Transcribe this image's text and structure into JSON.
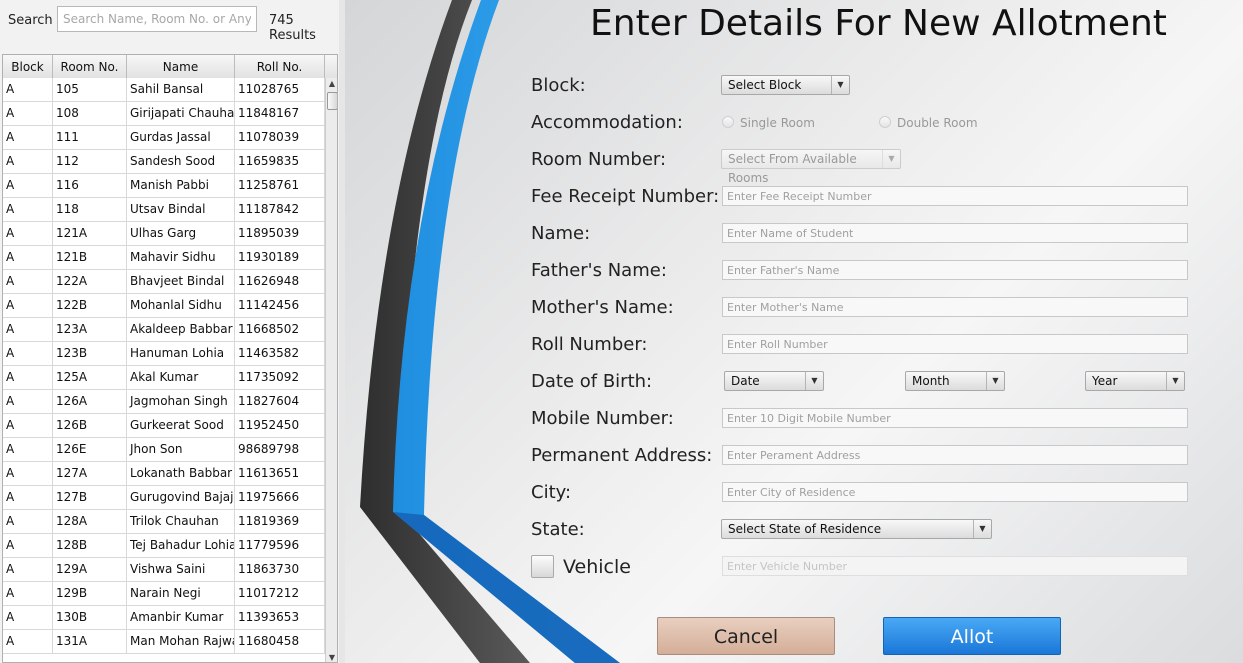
{
  "search": {
    "label": "Search",
    "placeholder": "Search Name, Room No. or Anything",
    "results": "745 Results"
  },
  "table": {
    "headers": [
      "Block",
      "Room No.",
      "Name",
      "Roll No."
    ],
    "rows": [
      [
        "A",
        "105",
        "Sahil Bansal",
        "11028765"
      ],
      [
        "A",
        "108",
        "Girijapati Chauhan",
        "11848167"
      ],
      [
        "A",
        "111",
        "Gurdas Jassal",
        "11078039"
      ],
      [
        "A",
        "112",
        "Sandesh Sood",
        "11659835"
      ],
      [
        "A",
        "116",
        "Manish Pabbi",
        "11258761"
      ],
      [
        "A",
        "118",
        "Utsav Bindal",
        "11187842"
      ],
      [
        "A",
        "121A",
        "Ulhas Garg",
        "11895039"
      ],
      [
        "A",
        "121B",
        "Mahavir Sidhu",
        "11930189"
      ],
      [
        "A",
        "122A",
        "Bhavjeet Bindal",
        "11626948"
      ],
      [
        "A",
        "122B",
        "Mohanlal Sidhu",
        "11142456"
      ],
      [
        "A",
        "123A",
        "Akaldeep Babbar",
        "11668502"
      ],
      [
        "A",
        "123B",
        "Hanuman Lohia",
        "11463582"
      ],
      [
        "A",
        "125A",
        "Akal Kumar",
        "11735092"
      ],
      [
        "A",
        "126A",
        "Jagmohan Singh",
        "11827604"
      ],
      [
        "A",
        "126B",
        "Gurkeerat Sood",
        "11952450"
      ],
      [
        "A",
        "126E",
        "Jhon Son",
        "98689798"
      ],
      [
        "A",
        "127A",
        "Lokanath Babbar",
        "11613651"
      ],
      [
        "A",
        "127B",
        "Gurugovind Bajaj",
        "11975666"
      ],
      [
        "A",
        "128A",
        "Trilok Chauhan",
        "11819369"
      ],
      [
        "A",
        "128B",
        "Tej Bahadur Lohia",
        "11779596"
      ],
      [
        "A",
        "129A",
        "Vishwa Saini",
        "11863730"
      ],
      [
        "A",
        "129B",
        "Narain Negi",
        "11017212"
      ],
      [
        "A",
        "130B",
        "Amanbir Kumar",
        "11393653"
      ],
      [
        "A",
        "131A",
        "Man Mohan Rajwal",
        "11680458"
      ]
    ]
  },
  "form": {
    "title": "Enter Details For New Allotment",
    "labels": {
      "block": "Block:",
      "accommodation": "Accommodation:",
      "room_number": "Room Number:",
      "fee_receipt": "Fee Receipt Number:",
      "name": "Name:",
      "father_name": "Father's Name:",
      "mother_name": "Mother's Name:",
      "roll_number": "Roll Number:",
      "dob": "Date of Birth:",
      "mobile": "Mobile Number:",
      "address": "Permanent Address:",
      "city": "City:",
      "state": "State:",
      "vehicle": "Vehicle"
    },
    "block_select": "Select Block",
    "single_room": "Single Room",
    "double_room": "Double Room",
    "room_select": "Select From Available Rooms",
    "placeholders": {
      "fee_receipt": "Enter Fee Receipt Number",
      "name": "Enter Name of Student",
      "father_name": "Enter Father's Name",
      "mother_name": "Enter Mother's Name",
      "roll_number": "Enter Roll Number",
      "mobile": "Enter 10 Digit Mobile Number",
      "address": "Enter Perament Address",
      "city": "Enter City of Residence",
      "vehicle": "Enter Vehicle Number"
    },
    "dob_date": "Date",
    "dob_month": "Month",
    "dob_year": "Year",
    "state_select": "Select State of Residence",
    "cancel": "Cancel",
    "allot": "Allot"
  },
  "colors": {
    "accent_blue": "#2196e8",
    "dark_stripe": "#444444",
    "cancel_bg": "#dcbba8",
    "allot_bg": "#2a8ce6"
  }
}
